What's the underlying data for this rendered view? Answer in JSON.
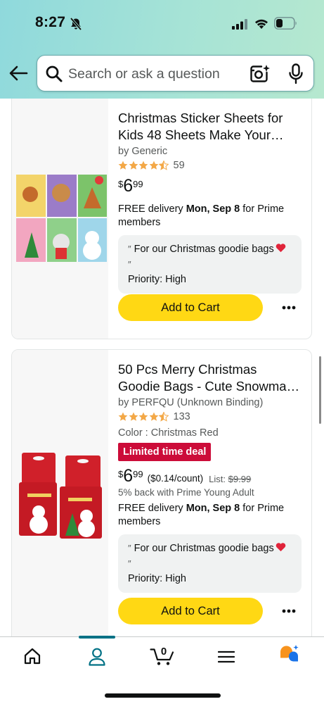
{
  "status_bar": {
    "time": "8:27"
  },
  "search": {
    "placeholder": "Search or ask a question"
  },
  "products": [
    {
      "title": "Christmas Sticker Sheets for Kids 48 Sheets Make Your…",
      "byline": "by Generic",
      "rating": 4.5,
      "rating_count": "59",
      "price_symbol": "$",
      "price_whole": "6",
      "price_fraction": "99",
      "delivery_prefix": "FREE delivery ",
      "delivery_date": "Mon, Sep 8",
      "delivery_suffix": " for Prime members",
      "note_text": "For our Christmas goodie bags",
      "priority": "Priority: High",
      "add_to_cart": "Add to Cart"
    },
    {
      "title": "50 Pcs Merry Christmas Goodie Bags - Cute Snowma…",
      "byline": "by PERFQU (Unknown Binding)",
      "rating": 4.5,
      "rating_count": "133",
      "color_label": "Color : ",
      "color_value": "Christmas Red",
      "deal_badge": "Limited time deal",
      "price_symbol": "$",
      "price_whole": "6",
      "price_fraction": "99",
      "unit_price": "($0.14/count)",
      "list_label": "List: ",
      "list_price": "$9.99",
      "cashback": "5% back with Prime Young Adult",
      "delivery_prefix": "FREE delivery ",
      "delivery_date": "Mon, Sep 8",
      "delivery_suffix": " for Prime members",
      "note_text": "For our Christmas goodie bags",
      "priority": "Priority: High",
      "add_to_cart": "Add to Cart"
    }
  ],
  "bottom_nav": {
    "active": "account",
    "cart_count": "0",
    "items": [
      "home",
      "account",
      "cart",
      "menu",
      "rufus"
    ]
  },
  "colors": {
    "header_gradient": [
      "#8fd9dc",
      "#b6e8cf"
    ],
    "star": "#f3a847",
    "add_to_cart": "#ffd814",
    "deal_badge": "#cc0c39",
    "nav_active": "#007185"
  }
}
